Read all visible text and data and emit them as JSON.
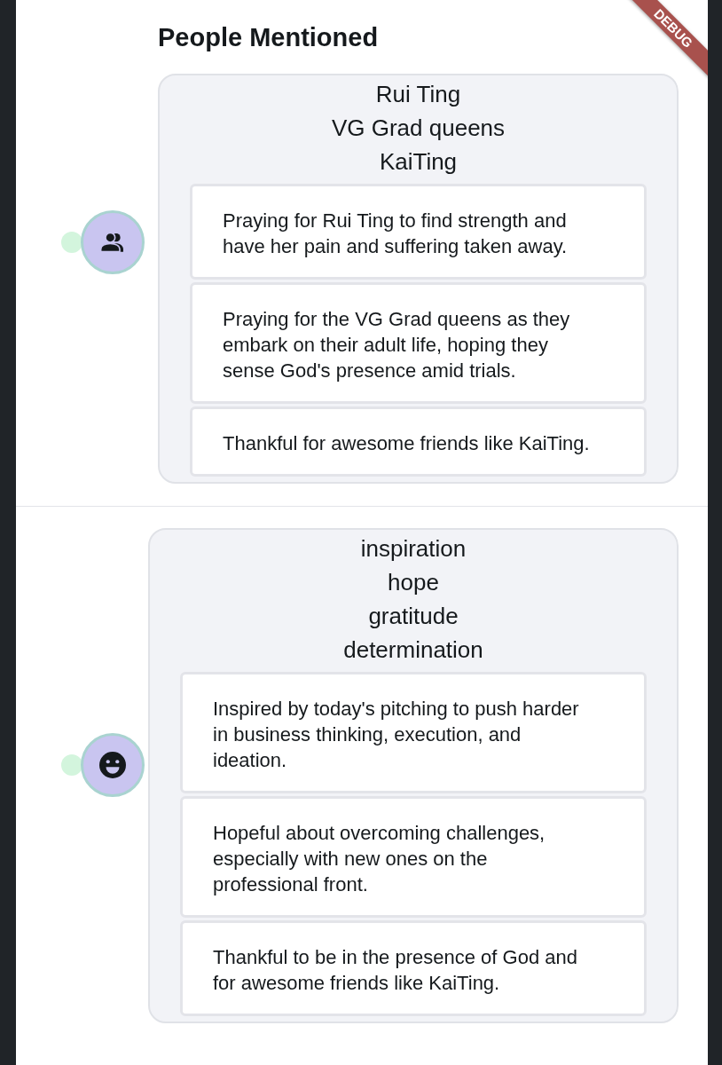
{
  "debug_banner": "DEBUG",
  "sections": [
    {
      "heading": "People Mentioned",
      "kind": "people",
      "tags": [
        "Rui Ting",
        "VG Grad queens",
        "KaiTing"
      ],
      "entries": [
        "Praying for Rui Ting to find strength and have her pain and suffering taken away.",
        "Praying for the VG Grad queens as they embark on their adult life, hoping they sense God's presence amid trials.",
        "Thankful for awesome friends like KaiTing."
      ]
    },
    {
      "kind": "emotion",
      "tags": [
        "inspiration",
        "hope",
        "gratitude",
        "determination"
      ],
      "entries": [
        "Inspired by today's pitching to push harder in business thinking, execution, and ideation.",
        "Hopeful about overcoming challenges, especially with new ones on the professional front.",
        "Thankful to be in the presence of God and for awesome friends like KaiTing."
      ]
    }
  ]
}
